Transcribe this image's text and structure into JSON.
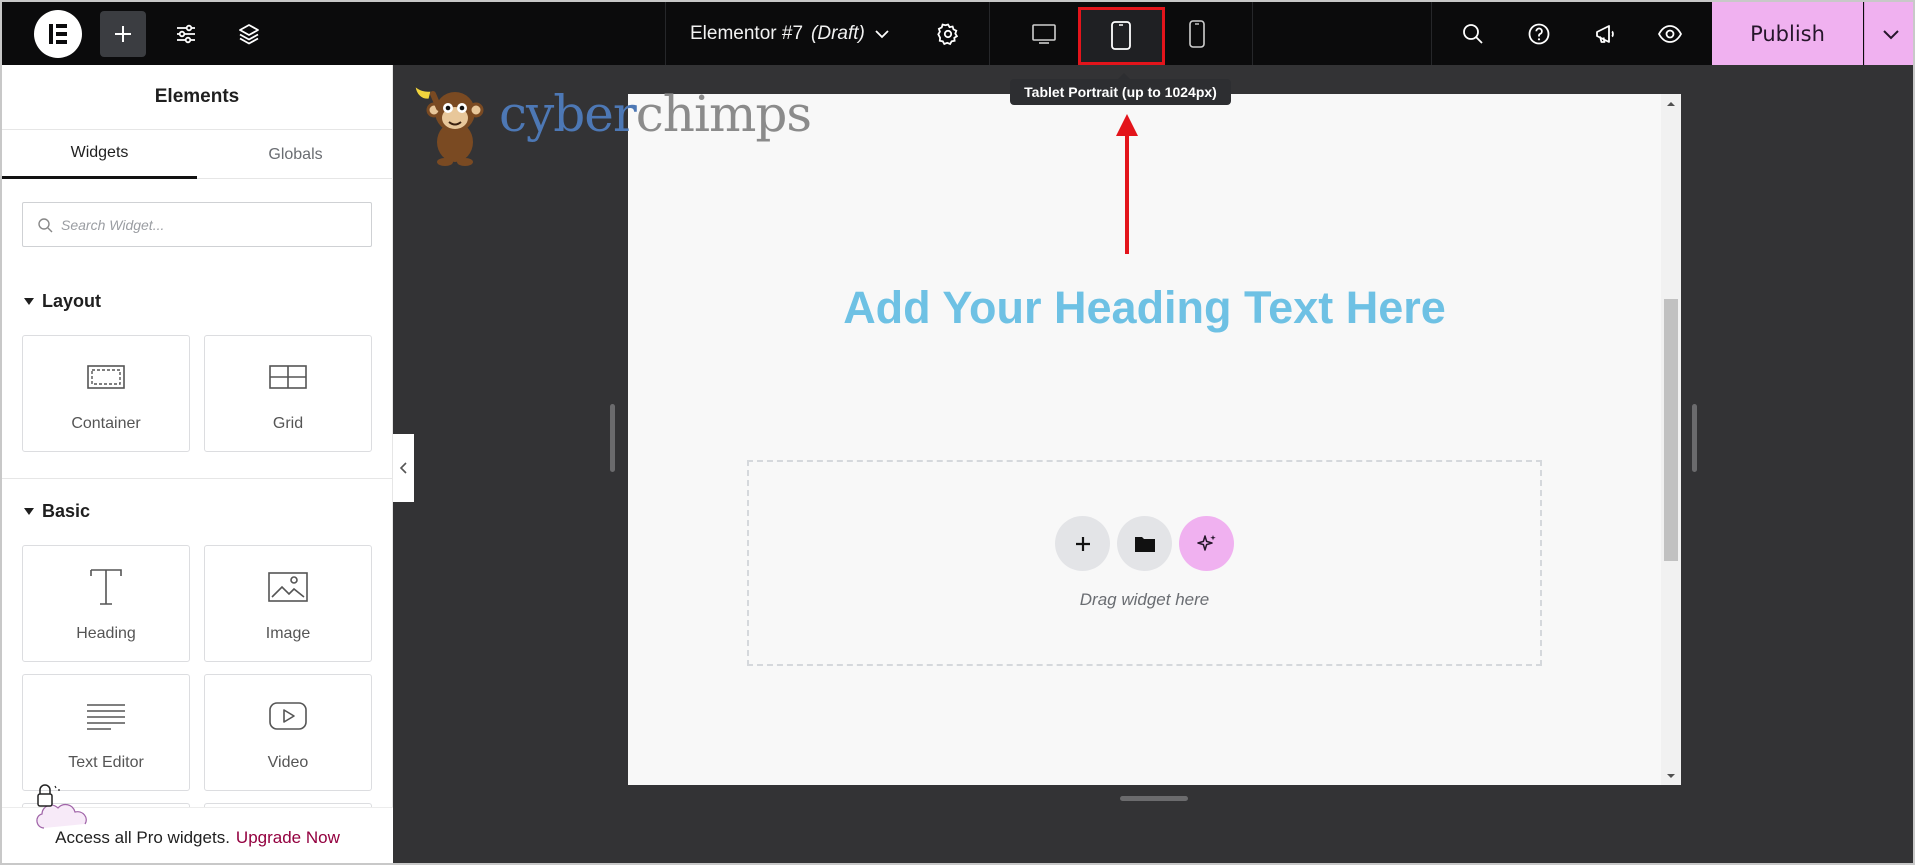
{
  "topbar": {
    "document_title": "Elementor #7",
    "document_status": "(Draft)",
    "publish_label": "Publish",
    "tooltip": "Tablet Portrait (up to 1024px)",
    "active_device": "tablet",
    "highlight_color": "#e3141b",
    "accent_color": "#f0b1f0"
  },
  "sidebar": {
    "title": "Elements",
    "tabs": [
      {
        "label": "Widgets",
        "active": true
      },
      {
        "label": "Globals",
        "active": false
      }
    ],
    "search_placeholder": "Search Widget...",
    "sections": [
      {
        "title": "Layout",
        "widgets": [
          {
            "label": "Container",
            "icon": "container-icon"
          },
          {
            "label": "Grid",
            "icon": "grid-icon"
          }
        ]
      },
      {
        "title": "Basic",
        "widgets": [
          {
            "label": "Heading",
            "icon": "heading-icon"
          },
          {
            "label": "Image",
            "icon": "image-icon"
          },
          {
            "label": "Text Editor",
            "icon": "text-editor-icon"
          },
          {
            "label": "Video",
            "icon": "video-icon"
          }
        ]
      }
    ],
    "footer_text": "Access all Pro widgets.",
    "footer_link": "Upgrade Now"
  },
  "canvas": {
    "brand_part1": "cyber",
    "brand_part2": "chimps",
    "heading": "Add Your Heading Text Here",
    "heading_color": "#6ec1e4",
    "drop_label": "Drag widget here"
  }
}
